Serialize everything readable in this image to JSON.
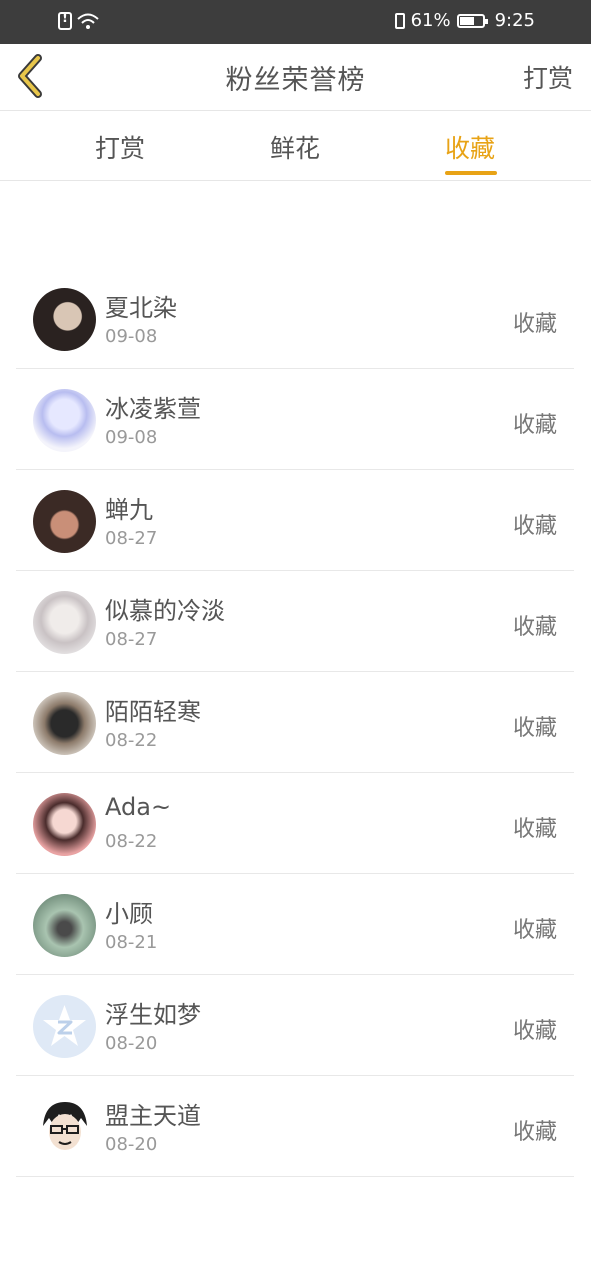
{
  "status_bar": {
    "battery": "61%",
    "time": "9:25",
    "icons": [
      "alert-icon",
      "wifi-icon",
      "vibrate-icon",
      "battery-icon"
    ]
  },
  "header": {
    "title": "粉丝荣誉榜",
    "right_action": "打赏",
    "back_icon": "chevron-left-icon"
  },
  "tabs": [
    {
      "label": "打赏",
      "active": false
    },
    {
      "label": "鲜花",
      "active": false
    },
    {
      "label": "收藏",
      "active": true
    }
  ],
  "colors": {
    "accent": "#e8a316",
    "text": "#555555",
    "subtext": "#999999"
  },
  "fans": [
    {
      "name": "夏北染",
      "date": "09-08",
      "action": "收藏"
    },
    {
      "name": "冰凌紫萱",
      "date": "09-08",
      "action": "收藏"
    },
    {
      "name": "蝉九",
      "date": "08-27",
      "action": "收藏"
    },
    {
      "name": "似慕的冷淡",
      "date": "08-27",
      "action": "收藏"
    },
    {
      "name": "陌陌轻寒",
      "date": "08-22",
      "action": "收藏"
    },
    {
      "name": "Ada~",
      "date": "08-22",
      "action": "收藏"
    },
    {
      "name": "小顾",
      "date": "08-21",
      "action": "收藏"
    },
    {
      "name": "浮生如梦",
      "date": "08-20",
      "action": "收藏"
    },
    {
      "name": "盟主天道",
      "date": "08-20",
      "action": "收藏"
    }
  ]
}
